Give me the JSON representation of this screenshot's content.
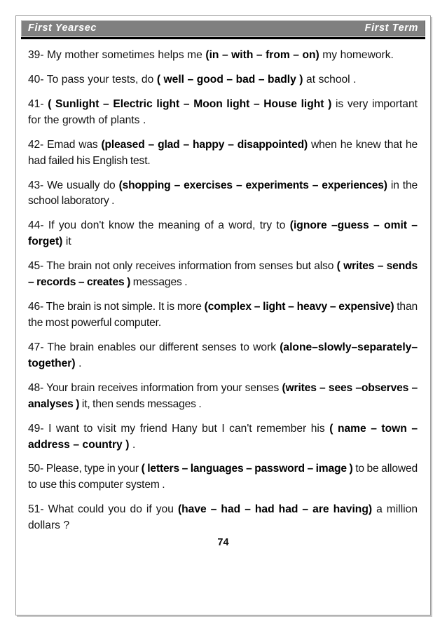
{
  "document": {
    "header": {
      "left_label": "First  Yearsec",
      "right_label": "First  Term"
    },
    "page_number": "74",
    "questions": [
      {
        "number": "39-",
        "segments": [
          {
            "text": "39- My mother sometimes helps me ",
            "bold": false
          },
          {
            "text": "(in – with – from – on)",
            "bold": true
          },
          {
            "text": " my homework.",
            "bold": false
          }
        ]
      },
      {
        "number": "40-",
        "segments": [
          {
            "text": "40- To pass your tests, do ",
            "bold": false
          },
          {
            "text": "( well – good – bad – badly )",
            "bold": true
          },
          {
            "text": " at school .",
            "bold": false
          }
        ]
      },
      {
        "number": "41-",
        "segments": [
          {
            "text": "41- ",
            "bold": false
          },
          {
            "text": "( Sunlight – Electric light – Moon light – House light )",
            "bold": true
          },
          {
            "text": " is very important for the growth of plants .",
            "bold": false
          }
        ]
      },
      {
        "number": "42-",
        "segments": [
          {
            "text": "42- Emad was ",
            "bold": false
          },
          {
            "text": "(pleased – glad – happy – disappointed)",
            "bold": true
          },
          {
            "text": " when he knew that he had failed his English test.",
            "bold": false
          }
        ]
      },
      {
        "number": "43-",
        "segments": [
          {
            "text": "43- We usually do ",
            "bold": false
          },
          {
            "text": "(shopping – exercises – experiments – experiences)",
            "bold": true
          },
          {
            "text": " in the school laboratory .",
            "bold": false
          }
        ]
      },
      {
        "number": "44-",
        "segments": [
          {
            "text": "44- If you don't know the meaning of a word, try to ",
            "bold": false
          },
          {
            "text": "(ignore –guess – omit – forget)",
            "bold": true
          },
          {
            "text": " it",
            "bold": false
          }
        ]
      },
      {
        "number": "45-",
        "segments": [
          {
            "text": "45- The brain not only receives information from senses but also ",
            "bold": false
          },
          {
            "text": "( writes – sends – records – creates )",
            "bold": true
          },
          {
            "text": " messages .",
            "bold": false
          }
        ]
      },
      {
        "number": "46-",
        "segments": [
          {
            "text": "46- The brain is not simple. It is more ",
            "bold": false
          },
          {
            "text": "(complex – light – heavy – expensive)",
            "bold": true
          },
          {
            "text": " than the most powerful computer.",
            "bold": false
          }
        ]
      },
      {
        "number": "47-",
        "segments": [
          {
            "text": "47- The brain enables our different senses to work ",
            "bold": false
          },
          {
            "text": "(alone–slowly–separately–together)",
            "bold": true
          },
          {
            "text": " .",
            "bold": false
          }
        ]
      },
      {
        "number": "48-",
        "segments": [
          {
            "text": "48- Your brain receives information from your senses ",
            "bold": false
          },
          {
            "text": "(writes – sees –observes – analyses )",
            "bold": true
          },
          {
            "text": " it, then sends messages .",
            "bold": false
          }
        ]
      },
      {
        "number": "49-",
        "segments": [
          {
            "text": "49- I want to visit my friend Hany but I can't remember his ",
            "bold": false
          },
          {
            "text": "( name – town – address – country )",
            "bold": true
          },
          {
            "text": " .",
            "bold": false
          }
        ]
      },
      {
        "number": "50-",
        "segments": [
          {
            "text": "50- Please, type in your ",
            "bold": false
          },
          {
            "text": "( letters – languages – password – image )",
            "bold": true
          },
          {
            "text": " to be allowed to use this computer system .",
            "bold": false
          }
        ]
      },
      {
        "number": "51-",
        "segments": [
          {
            "text": "51- What could you do if you ",
            "bold": false
          },
          {
            "text": "(have – had – had had – are having)",
            "bold": true
          },
          {
            "text": " a million dollars ?",
            "bold": false
          }
        ]
      }
    ]
  }
}
